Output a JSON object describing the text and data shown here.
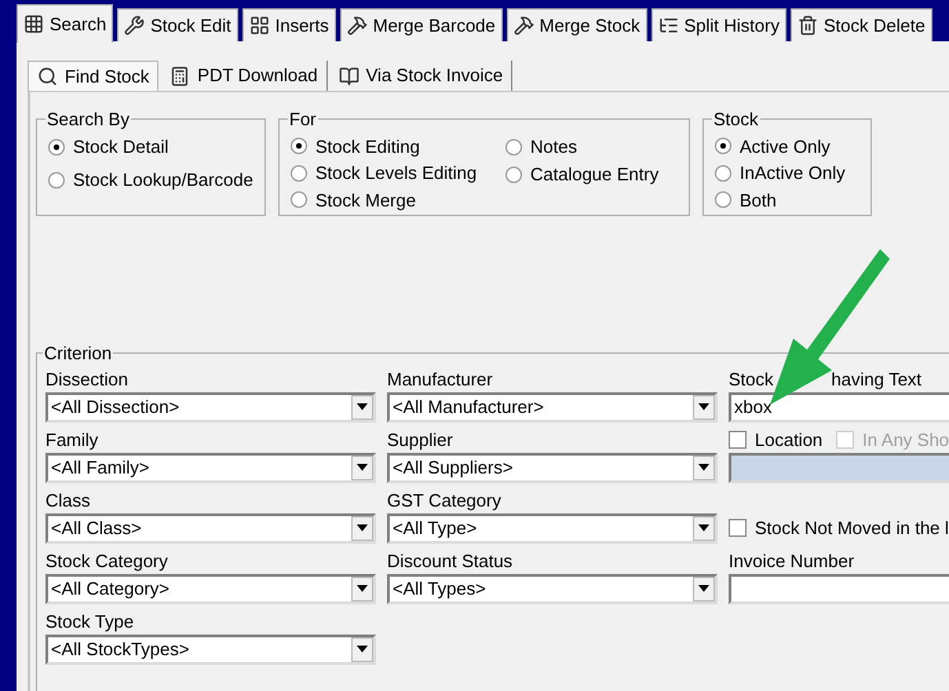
{
  "tabs": [
    {
      "label": "Search",
      "selected": true
    },
    {
      "label": "Stock Edit",
      "selected": false
    },
    {
      "label": "Inserts",
      "selected": false
    },
    {
      "label": "Merge Barcode",
      "selected": false
    },
    {
      "label": "Merge Stock",
      "selected": false
    },
    {
      "label": "Split History",
      "selected": false
    },
    {
      "label": "Stock Delete",
      "selected": false
    }
  ],
  "subtabs": [
    {
      "label": "Find Stock",
      "selected": true
    },
    {
      "label": "PDT Download",
      "selected": false
    },
    {
      "label": "Via Stock Invoice",
      "selected": false
    }
  ],
  "groups": [
    {
      "title": "Search By",
      "columns": [
        [
          {
            "label": "Stock Detail",
            "selected": true
          },
          {
            "label": "Stock Lookup/Barcode",
            "selected": false
          }
        ]
      ]
    },
    {
      "title": "For",
      "columns": [
        [
          {
            "label": "Stock Editing",
            "selected": true
          },
          {
            "label": "Stock Levels Editing",
            "selected": false
          },
          {
            "label": "Stock Merge",
            "selected": false
          }
        ],
        [
          {
            "label": "Notes",
            "selected": false
          },
          {
            "label": "Catalogue Entry",
            "selected": false
          }
        ]
      ]
    },
    {
      "title": "Stock",
      "columns": [
        [
          {
            "label": "Active Only",
            "selected": true
          },
          {
            "label": "InActive Only",
            "selected": false
          },
          {
            "label": "Both",
            "selected": false
          }
        ]
      ]
    }
  ],
  "criterion": {
    "title": "Criterion",
    "columns": [
      [
        {
          "kind": "combo",
          "label": "Dissection",
          "value": "<All Dissection>"
        },
        {
          "kind": "combo",
          "label": "Family",
          "value": "<All Family>"
        },
        {
          "kind": "combo",
          "label": "Class",
          "value": "<All Class>"
        },
        {
          "kind": "combo",
          "label": "Stock Category",
          "value": "<All Category>"
        },
        {
          "kind": "combo",
          "label": "Stock Type",
          "value": "<All StockTypes>"
        }
      ],
      [
        {
          "kind": "combo",
          "label": "Manufacturer",
          "value": "<All Manufacturer>"
        },
        {
          "kind": "combo",
          "label": "Supplier",
          "value": "<All Suppliers>"
        },
        {
          "kind": "combo",
          "label": "GST Category",
          "value": "<All Type>"
        },
        {
          "kind": "combo",
          "label": "Discount Status",
          "value": "<All Types>"
        }
      ],
      [
        {
          "kind": "field",
          "label_parts": [
            "Stock",
            "having Text"
          ],
          "value": "xbox"
        },
        {
          "kind": "checks_field",
          "checks": [
            {
              "label": "Location",
              "checked": false,
              "disabled": false
            },
            {
              "label": "In Any Sho",
              "checked": false,
              "disabled": true
            }
          ],
          "disabled": true
        },
        {
          "kind": "check",
          "label": "Stock Not Moved in the l",
          "checked": false
        },
        {
          "kind": "field",
          "label_parts": [
            "Invoice Number"
          ]
        }
      ]
    ]
  }
}
